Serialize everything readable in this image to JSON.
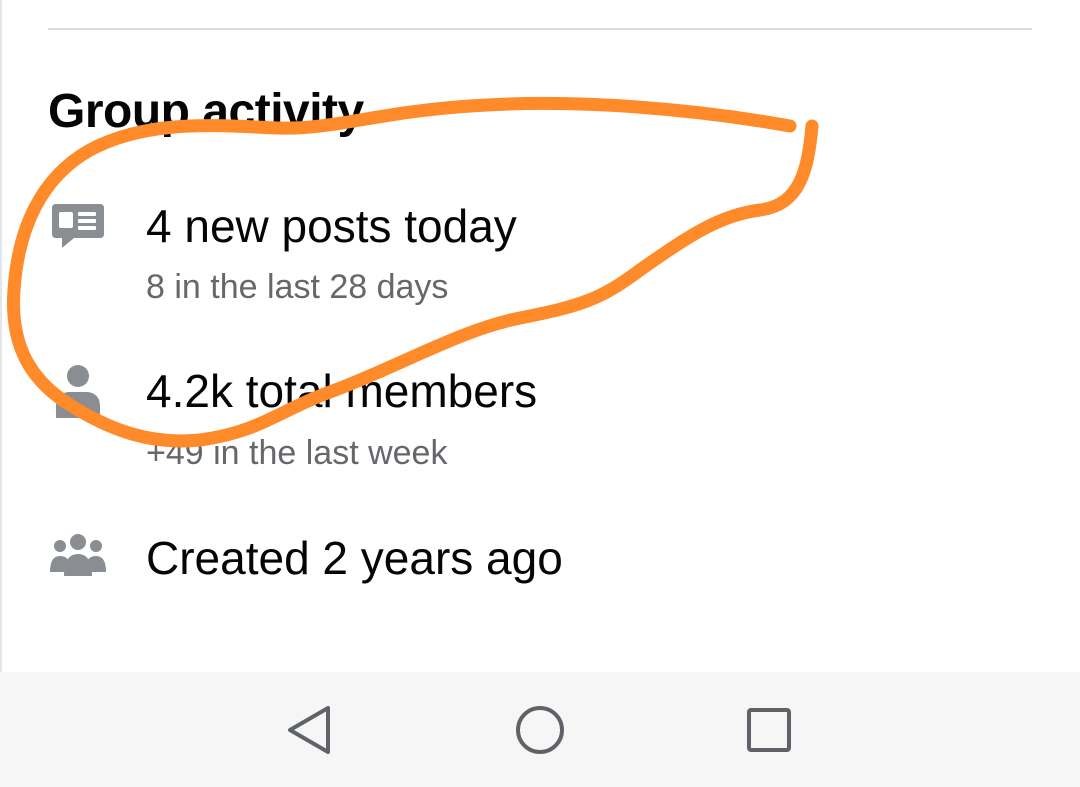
{
  "section": {
    "title": "Group activity"
  },
  "activity": {
    "posts": {
      "icon": "chat-bubble-icon",
      "primary": "4 new posts today",
      "secondary": "8 in the last 28 days"
    },
    "members": {
      "icon": "person-icon",
      "primary": "4.2k total members",
      "secondary": "+49 in the last week"
    },
    "created": {
      "icon": "group-icon",
      "primary": "Created 2 years ago"
    }
  },
  "annotation": {
    "color": "#ff8a2a",
    "type": "freehand-circle"
  },
  "nav": {
    "back_icon": "back-triangle-icon",
    "home_icon": "home-circle-icon",
    "recents_icon": "recents-square-icon",
    "icon_color": "#5f6368"
  },
  "colors": {
    "primary_text": "#050505",
    "secondary_text": "#65676b",
    "icon_gray": "#8a8d91"
  }
}
